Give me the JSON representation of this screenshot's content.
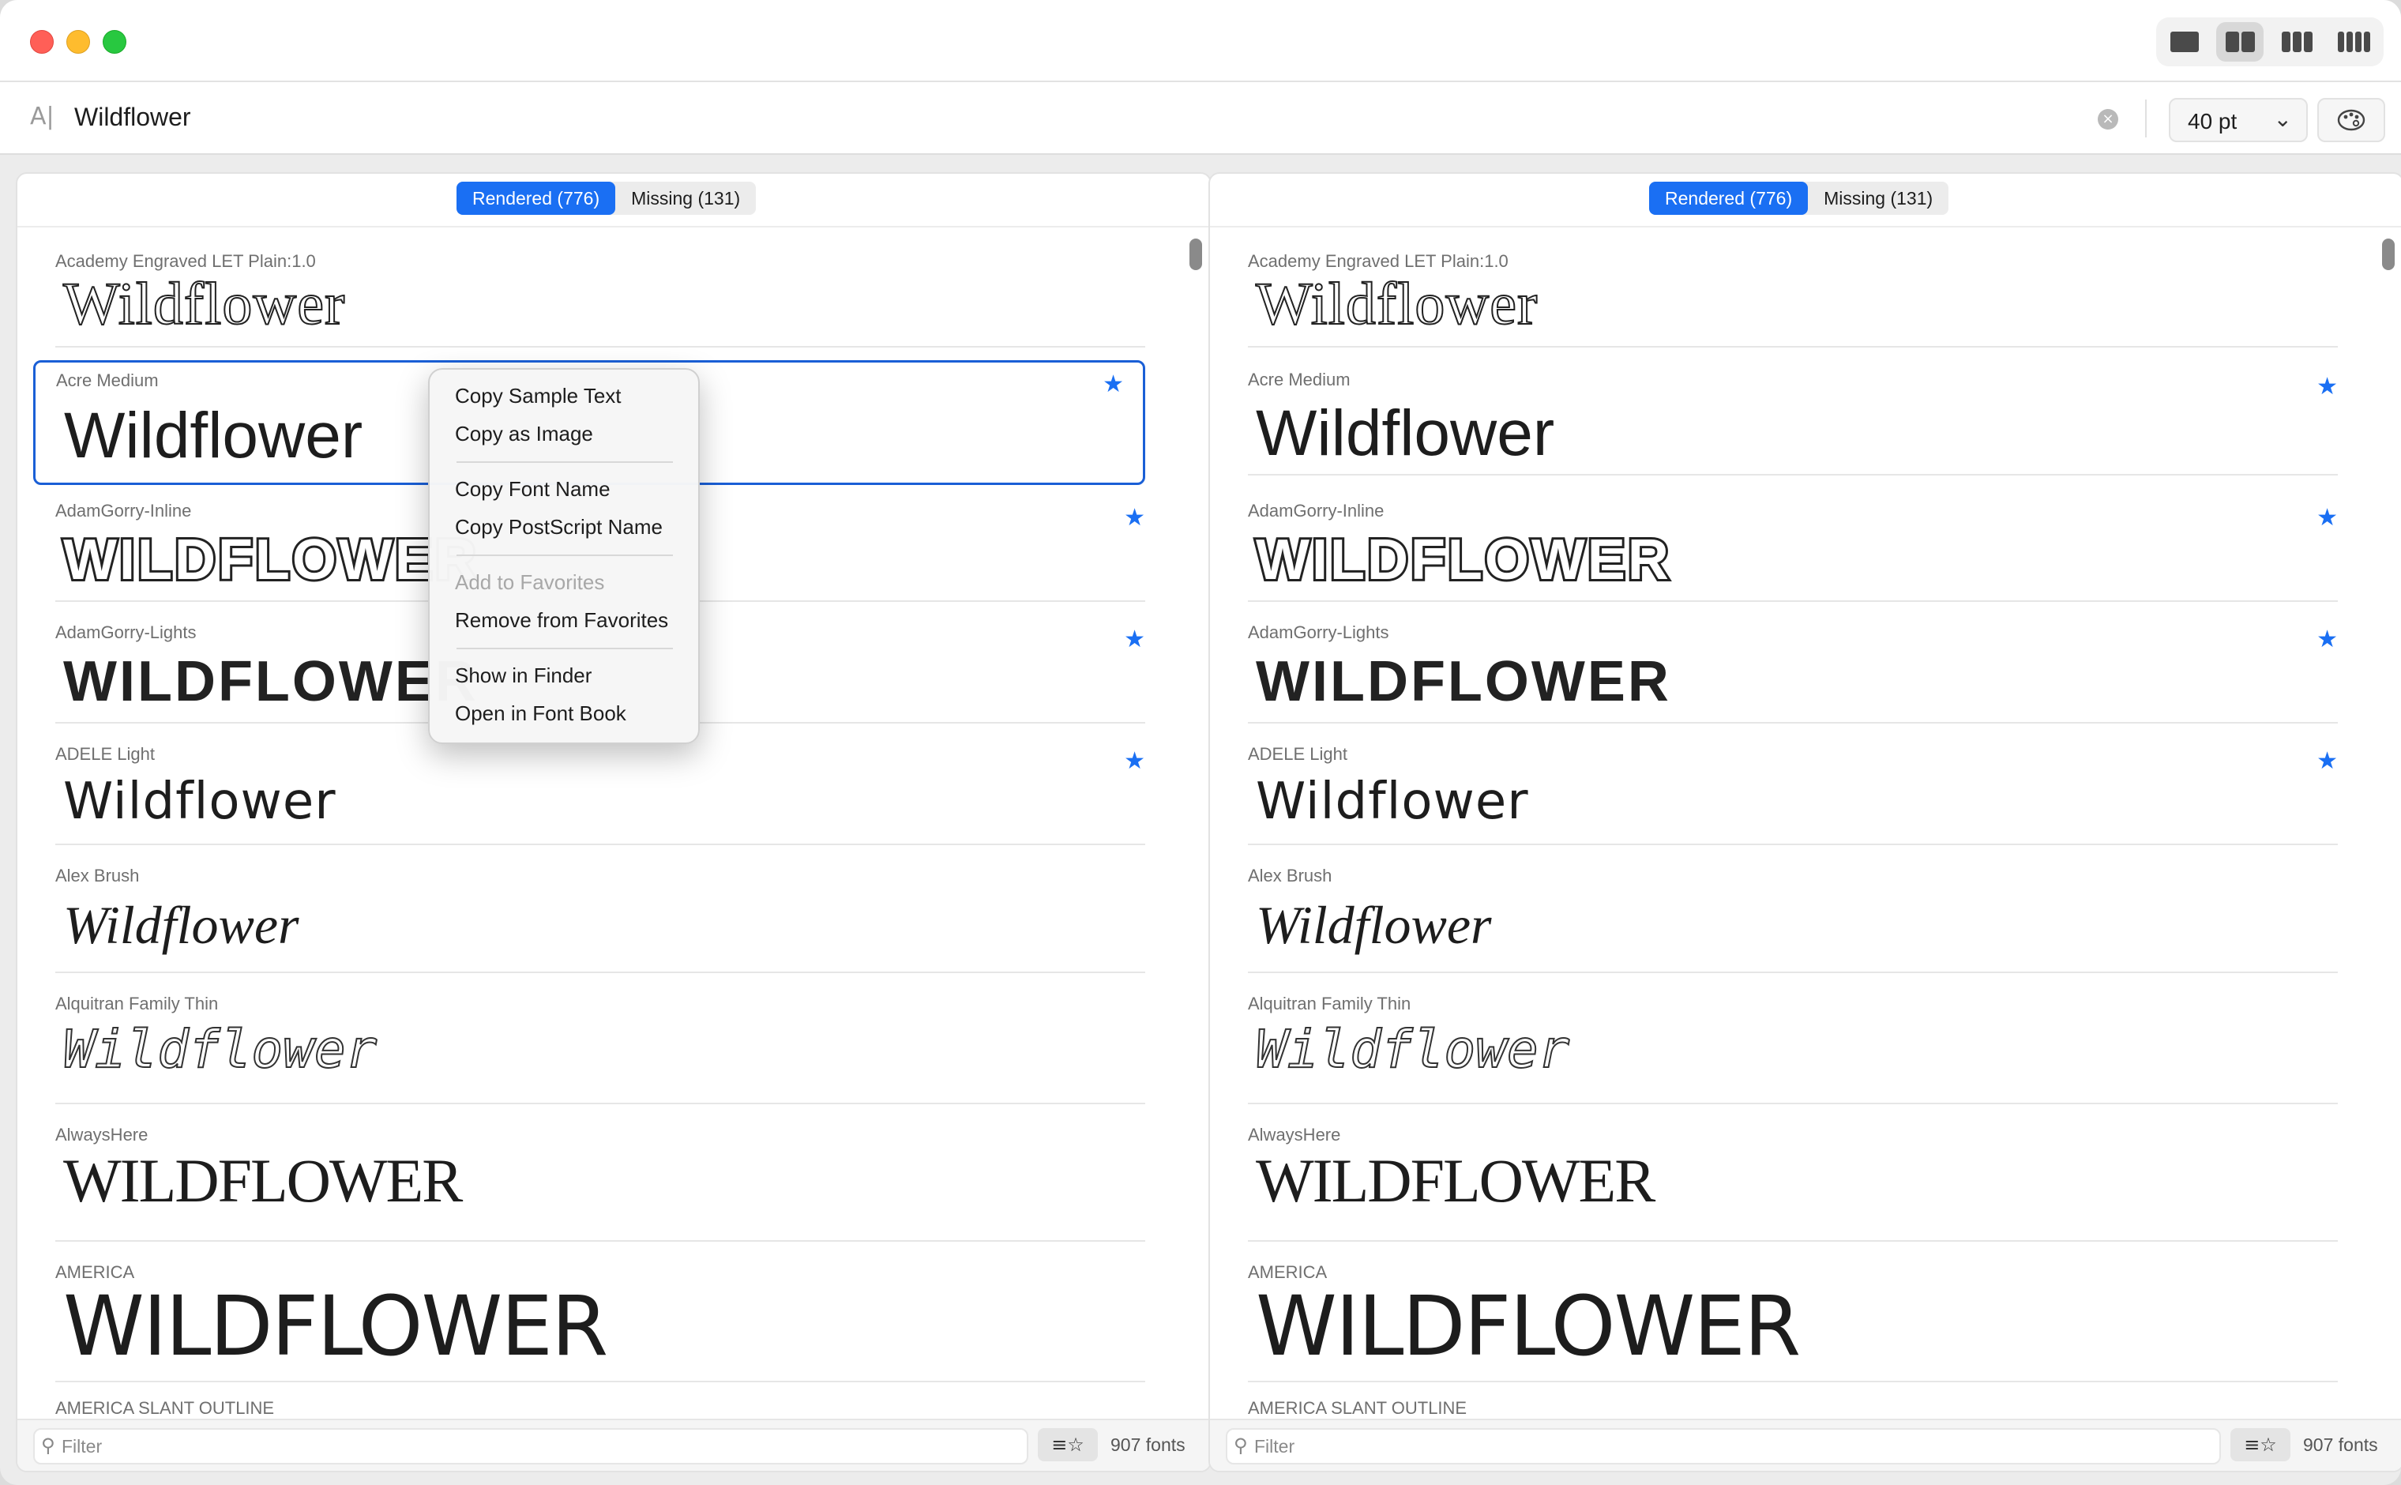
{
  "window": {
    "layout_options": [
      "single-column",
      "two-columns",
      "three-columns",
      "four-columns"
    ],
    "active_layout": "two-columns"
  },
  "search": {
    "icon": "text-cursor-icon",
    "value": "Wildflower",
    "size": "40 pt"
  },
  "panels": [
    {
      "tabs": [
        {
          "label": "Rendered (776)",
          "active": true
        },
        {
          "label": "Missing (131)",
          "active": false
        }
      ],
      "filter_placeholder": "Filter",
      "sort_icon": "≡☆",
      "count": "907 fonts"
    },
    {
      "tabs": [
        {
          "label": "Rendered (776)",
          "active": true
        },
        {
          "label": "Missing (131)",
          "active": false
        }
      ],
      "filter_placeholder": "Filter",
      "sort_icon": "≡☆",
      "count": "907 fonts"
    }
  ],
  "fonts": [
    {
      "name": "Academy Engraved LET Plain:1.0",
      "sample": "Wildflower",
      "favorite": false
    },
    {
      "name": "Acre Medium",
      "sample": "Wildflower",
      "favorite": true
    },
    {
      "name": "AdamGorry-Inline",
      "sample": "WILDFLOWER",
      "favorite": true
    },
    {
      "name": "AdamGorry-Lights",
      "sample": "WILDFLOWER",
      "favorite": true
    },
    {
      "name": "ADELE Light",
      "sample": "Wildflower",
      "favorite": true
    },
    {
      "name": "Alex Brush",
      "sample": "Wildflower",
      "favorite": false
    },
    {
      "name": "Alquitran Family Thin",
      "sample": "Wildflower",
      "favorite": false
    },
    {
      "name": "AlwaysHere",
      "sample": "WILDFLOWER",
      "favorite": false
    },
    {
      "name": "AMERICA",
      "sample": "WILDFLOWER",
      "favorite": false
    },
    {
      "name": "AMERICA  SLANT OUTLINE",
      "sample": "",
      "favorite": false
    }
  ],
  "context_menu": {
    "items": [
      {
        "label": "Copy Sample Text",
        "enabled": true
      },
      {
        "label": "Copy as Image",
        "enabled": true
      },
      {
        "label": "Copy Font Name",
        "enabled": true
      },
      {
        "label": "Copy PostScript Name",
        "enabled": true
      },
      {
        "label": "Add to Favorites",
        "enabled": false
      },
      {
        "label": "Remove from Favorites",
        "enabled": true
      },
      {
        "label": "Show in Finder",
        "enabled": true
      },
      {
        "label": "Open in Font Book",
        "enabled": true
      }
    ]
  },
  "colors": {
    "accent": "#1a6ff3",
    "selection_border": "#1a5fd6",
    "close": "#ff5f57",
    "minimize": "#febc2e",
    "zoom": "#28c840"
  }
}
